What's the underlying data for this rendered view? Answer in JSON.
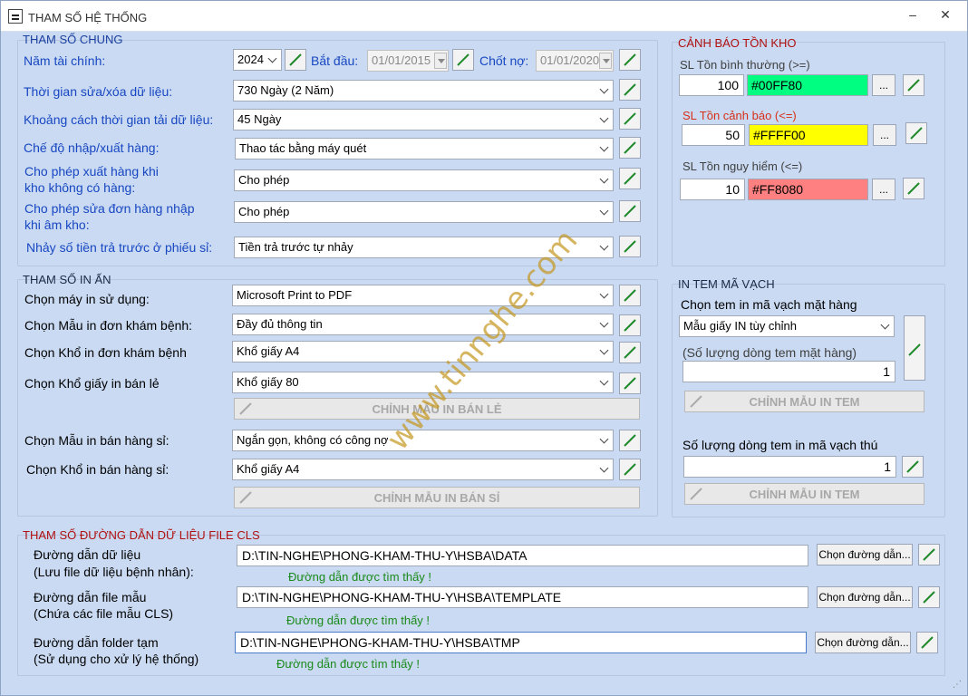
{
  "window": {
    "title": "THAM SỐ HỆ THỐNG",
    "minimize": "–",
    "close": "✕"
  },
  "general": {
    "title": "THAM SỐ CHUNG",
    "fiscal_year_label": "Năm tài chính:",
    "fiscal_year_value": "2024",
    "start_label": "Bắt đầu:",
    "start_value": "01/01/2015",
    "debt_close_label": "Chốt nợ:",
    "debt_close_value": "01/01/2020",
    "edit_time_label": "Thời gian sửa/xóa dữ liệu:",
    "edit_time_value": "730 Ngày (2 Năm)",
    "reload_label": "Khoảng cách thời gian tải dữ liệu:",
    "reload_value": "45 Ngày",
    "io_mode_label": "Chế độ nhập/xuất hàng:",
    "io_mode_value": "Thao tác bằng máy quét",
    "export_empty_label1": "Cho phép xuất hàng khi",
    "export_empty_label2": "kho không có hàng:",
    "export_empty_value": "Cho phép",
    "edit_import_label1": "Cho phép sửa đơn hàng nhập",
    "edit_import_label2": "khi âm kho:",
    "edit_import_value": "Cho phép",
    "prepay_label": "Nhảy số tiền trả trước ở phiếu sỉ:",
    "prepay_value": "Tiền trả trước tự nhảy"
  },
  "print": {
    "title": "THAM SỐ IN ẤN",
    "printer_label": "Chọn máy in sử dụng:",
    "printer_value": "Microsoft Print to PDF",
    "exam_template_label": "Chọn Mẫu in đơn khám bệnh:",
    "exam_template_value": "Đầy đủ thông tin",
    "exam_paper_label": "Chọn Khổ in đơn khám bệnh",
    "exam_paper_value": "Khổ giấy A4",
    "retail_paper_label": "Chọn Khổ giấy in bán lẻ",
    "retail_paper_value": "Khổ giấy 80",
    "retail_edit_button": "CHỈNH MẪU IN BÁN LẺ",
    "wholesale_template_label": "Chọn Mẫu in bán hàng sỉ:",
    "wholesale_template_value": "Ngắn gọn, không có công nợ",
    "wholesale_paper_label": "Chọn Khổ in bán hàng sỉ:",
    "wholesale_paper_value": "Khổ giấy A4",
    "wholesale_edit_button": "CHỈNH MẪU IN BÁN SỈ"
  },
  "stock": {
    "title": "CẢNH BÁO TỒN KHO",
    "normal_label": "SL Tồn bình thường (>=)",
    "normal_value": "100",
    "normal_color": "#00FF80",
    "warn_label": "SL Tồn cảnh báo (<=)",
    "warn_value": "50",
    "warn_color": "#FFFF00",
    "danger_label": "SL Tồn nguy hiểm (<=)",
    "danger_value": "10",
    "danger_color": "#FF8080",
    "browse": "..."
  },
  "barcode": {
    "title": "IN TEM MÃ VẠCH",
    "item_label": "Chọn tem in mã vạch mặt hàng",
    "item_value": "Mẫu giấy IN tùy chỉnh",
    "rows_label": "(Số lượng dòng tem mặt hàng)",
    "rows_value": "1",
    "edit_button": "CHỈNH MẪU IN TEM",
    "pet_rows_label": "Số lượng dòng tem in mã vạch thú",
    "pet_rows_value": "1",
    "pet_edit_button": "CHỈNH MẪU IN TEM"
  },
  "paths": {
    "title": "THAM SỐ ĐƯỜNG DẪN DỮ LIỆU FILE CLS",
    "data_label1": "Đường dẫn dữ liệu",
    "data_label2": "(Lưu file dữ liệu bệnh nhân):",
    "data_value": "D:\\TIN-NGHE\\PHONG-KHAM-THU-Y\\HSBA\\DATA",
    "data_status": "Đường dẫn được tìm thấy !",
    "template_label1": "Đường dẫn file mẫu",
    "template_label2": "(Chứa các file mẫu CLS)",
    "template_value": "D:\\TIN-NGHE\\PHONG-KHAM-THU-Y\\HSBA\\TEMPLATE",
    "template_status": "Đường dẫn được tìm thấy !",
    "temp_label1": "Đường dẫn folder tạm",
    "temp_label2": "(Sử dụng cho xử lý hệ thống)",
    "temp_value": "D:\\TIN-NGHE\\PHONG-KHAM-THU-Y\\HSBA\\TMP",
    "temp_status": "Đường dẫn được tìm thấy !",
    "choose_button": "Chọn đường dẫn..."
  },
  "watermark": "www.tinnghe.com"
}
